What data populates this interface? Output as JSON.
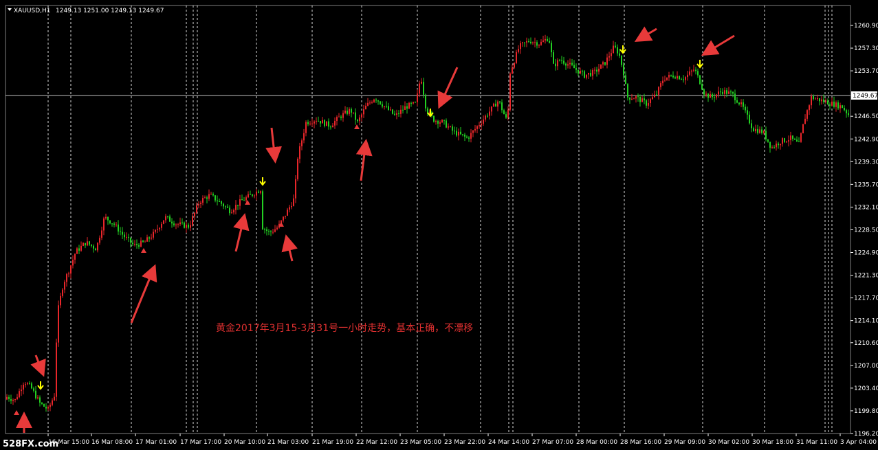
{
  "header": {
    "symbol": "XAUUSD,H1",
    "ohlc": "1249.13 1251.00 1249.13 1249.67"
  },
  "annotation": "黄金2017年3月15-3月31号一小时走势，基本正确，不漂移",
  "watermark": "528FX.com",
  "colors": {
    "background": "#000000",
    "up_candle": "#e8262a",
    "down_candle": "#22d022",
    "price_line": "#c0c0c0",
    "arrow_red": "#e83a3a",
    "arrow_yellow": "#ffff00",
    "axis": "#ffffff"
  },
  "chart_data": {
    "type": "candlestick",
    "title": "XAUUSD,H1",
    "current_price": 1249.67,
    "ylim": [
      1196.2,
      1262.8
    ],
    "y_ticks": [
      "1260.90",
      "1257.30",
      "1253.70",
      "1249.67",
      "1246.50",
      "1242.90",
      "1239.30",
      "1235.70",
      "1232.10",
      "1228.50",
      "1224.90",
      "1221.30",
      "1217.70",
      "1214.10",
      "1210.60",
      "1207.00",
      "1203.40",
      "1199.80",
      "1196.20"
    ],
    "x_ticks": [
      "16 Mar 15:00",
      "16 Mar 08:00",
      "17 Mar 01:00",
      "17 Mar 17:00",
      "20 Mar 10:00",
      "21 Mar 03:00",
      "21 Mar 19:00",
      "22 Mar 12:00",
      "23 Mar 05:00",
      "23 Mar 22:00",
      "24 Mar 14:00",
      "27 Mar 07:00",
      "28 Mar 00:00",
      "28 Mar 16:00",
      "29 Mar 09:00",
      "30 Mar 02:00",
      "30 Mar 18:00",
      "31 Mar 11:00",
      "3 Apr 04:00"
    ],
    "day_separators_dashed": true,
    "price_path": [
      [
        0,
        1200.0
      ],
      [
        10,
        1202.0
      ],
      [
        22,
        1201.5
      ],
      [
        35,
        1204.5
      ],
      [
        45,
        1203.5
      ],
      [
        58,
        1201.0
      ],
      [
        70,
        1200.0
      ],
      [
        80,
        1202.5
      ],
      [
        83,
        1215.0
      ],
      [
        92,
        1220.0
      ],
      [
        100,
        1222.0
      ],
      [
        110,
        1225.0
      ],
      [
        125,
        1226.5
      ],
      [
        140,
        1225.5
      ],
      [
        152,
        1230.5
      ],
      [
        165,
        1229.5
      ],
      [
        180,
        1227.5
      ],
      [
        195,
        1226.0
      ],
      [
        210,
        1226.5
      ],
      [
        225,
        1228.0
      ],
      [
        240,
        1230.5
      ],
      [
        255,
        1229.5
      ],
      [
        275,
        1229.0
      ],
      [
        290,
        1233.0
      ],
      [
        305,
        1234.0
      ],
      [
        318,
        1233.0
      ],
      [
        335,
        1231.5
      ],
      [
        350,
        1233.0
      ],
      [
        365,
        1234.0
      ],
      [
        380,
        1235.0
      ],
      [
        381,
        1229.0
      ],
      [
        392,
        1228.0
      ],
      [
        405,
        1229.0
      ],
      [
        418,
        1231.5
      ],
      [
        428,
        1233.5
      ],
      [
        433,
        1240.0
      ],
      [
        445,
        1245.5
      ],
      [
        460,
        1246.0
      ],
      [
        480,
        1245.0
      ],
      [
        495,
        1246.5
      ],
      [
        510,
        1247.5
      ],
      [
        520,
        1245.5
      ],
      [
        532,
        1248.0
      ],
      [
        545,
        1249.5
      ],
      [
        560,
        1248.0
      ],
      [
        575,
        1246.5
      ],
      [
        590,
        1248.0
      ],
      [
        605,
        1248.5
      ],
      [
        612,
        1253.0
      ],
      [
        620,
        1247.5
      ],
      [
        630,
        1246.0
      ],
      [
        645,
        1245.5
      ],
      [
        660,
        1244.0
      ],
      [
        680,
        1243.0
      ],
      [
        695,
        1245.0
      ],
      [
        710,
        1247.0
      ],
      [
        725,
        1249.0
      ],
      [
        738,
        1245.5
      ],
      [
        742,
        1253.5
      ],
      [
        755,
        1257.5
      ],
      [
        770,
        1258.5
      ],
      [
        785,
        1258.0
      ],
      [
        798,
        1259.0
      ],
      [
        805,
        1254.5
      ],
      [
        815,
        1255.5
      ],
      [
        830,
        1254.5
      ],
      [
        850,
        1253.0
      ],
      [
        865,
        1253.5
      ],
      [
        880,
        1255.0
      ],
      [
        893,
        1257.5
      ],
      [
        900,
        1256.5
      ],
      [
        908,
        1253.0
      ],
      [
        912,
        1249.5
      ],
      [
        925,
        1249.5
      ],
      [
        940,
        1248.5
      ],
      [
        955,
        1250.0
      ],
      [
        965,
        1252.5
      ],
      [
        980,
        1253.0
      ],
      [
        995,
        1252.5
      ],
      [
        1010,
        1254.0
      ],
      [
        1018,
        1252.0
      ],
      [
        1025,
        1250.0
      ],
      [
        1035,
        1249.5
      ],
      [
        1050,
        1250.5
      ],
      [
        1065,
        1250.0
      ],
      [
        1080,
        1248.0
      ],
      [
        1095,
        1244.5
      ],
      [
        1110,
        1244.0
      ],
      [
        1122,
        1241.5
      ],
      [
        1135,
        1242.5
      ],
      [
        1150,
        1243.0
      ],
      [
        1162,
        1242.0
      ],
      [
        1170,
        1246.0
      ],
      [
        1180,
        1249.5
      ],
      [
        1195,
        1249.0
      ],
      [
        1210,
        1248.5
      ],
      [
        1225,
        1248.0
      ],
      [
        1236,
        1246.5
      ]
    ]
  }
}
